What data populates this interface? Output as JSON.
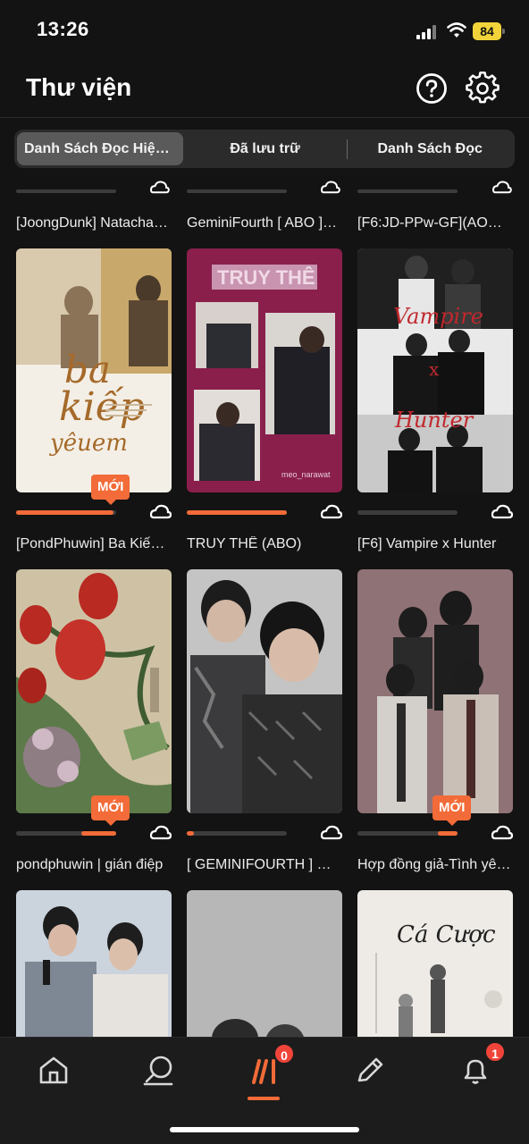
{
  "status": {
    "time": "13:26",
    "battery": "84"
  },
  "header": {
    "title": "Thư viện",
    "help_icon": "help-circle-icon",
    "settings_icon": "gear-icon"
  },
  "tabs": [
    {
      "label": "Danh Sách Đọc Hiện…",
      "active": true
    },
    {
      "label": "Đã lưu trữ",
      "active": false
    },
    {
      "label": "Danh Sách Đọc",
      "active": false
    }
  ],
  "top_row_titles": [
    "[JoongDunk] Natacha…",
    "GeminiFourth [ ABO ]…",
    "[F6:JD-PPw-GF](AOB)…"
  ],
  "books": [
    {
      "title": "[PondPhuwin] Ba Kiế…",
      "cover_text": "ba kiếp yêu em",
      "progress": 0.97,
      "badge": "MỚI"
    },
    {
      "title": "TRUY THÊ (ABO)",
      "cover_text": "TRUY THÊ",
      "cover_caption": "meo_narawat",
      "progress": 1.0,
      "badge": ""
    },
    {
      "title": "[F6] Vampire x Hunter",
      "cover_text": "Vampire x Hunter",
      "progress": 0.0,
      "badge": ""
    },
    {
      "title": "pondphuwin | gián điệp",
      "cover_text": "",
      "progress": 1.0,
      "badge": "MỚI",
      "progress_start": 0.65
    },
    {
      "title": "[ GEMINIFOURTH ] Phi…",
      "cover_text": "",
      "progress": 0.07,
      "badge": ""
    },
    {
      "title": "Hợp đồng giả-Tình yê…",
      "cover_text": "",
      "progress": 1.0,
      "badge": "MỚI",
      "progress_start": 0.8
    },
    {
      "title": "",
      "cover_text": "",
      "progress": 0,
      "badge": ""
    },
    {
      "title": "",
      "cover_text": "",
      "progress": 0,
      "badge": ""
    },
    {
      "title": "",
      "cover_text": "Cá Cược",
      "progress": 0,
      "badge": ""
    }
  ],
  "bottom_nav": [
    {
      "icon": "home-icon"
    },
    {
      "icon": "search-icon"
    },
    {
      "icon": "library-icon",
      "badge": "0",
      "active": true
    },
    {
      "icon": "pencil-icon"
    },
    {
      "icon": "bell-icon",
      "badge": "1"
    }
  ],
  "colors": {
    "accent": "#f26b38",
    "badge_red": "#f0443a",
    "background": "#131313"
  }
}
